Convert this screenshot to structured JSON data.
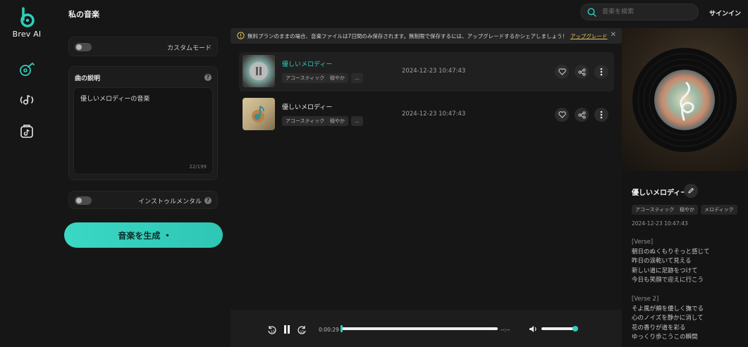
{
  "app": {
    "name": "Brev AI",
    "brand_color": "#2ecfbb"
  },
  "header": {
    "title": "私の音楽",
    "search_placeholder": "音楽を検索",
    "signin": "サインイン"
  },
  "sidebar": {
    "items": [
      {
        "icon": "music-disc-icon",
        "active": true
      },
      {
        "icon": "music-broadcast-icon",
        "active": false
      },
      {
        "icon": "tiktok-bag-icon",
        "active": false
      }
    ]
  },
  "left_panel": {
    "custom_mode_label": "カスタムモード",
    "description_label": "曲の説明",
    "description_value": "優しいメロディーの音楽",
    "char_count": "22/199",
    "instrumental_label": "インストゥルメンタル",
    "generate_button": "音楽を生成",
    "generate_dot": "•"
  },
  "notice": {
    "text": "無料プランのままの場合、音楽ファイルは7日間のみ保存されます。無制限で保存するには、アップグレードするかシェアしましょう！",
    "link": "アップグレード"
  },
  "tracks": [
    {
      "title": "優しいメロディー",
      "tags": [
        "アコースティック",
        "穏やか",
        "..."
      ],
      "date": "2024-12-23 10:47:43",
      "playing": true
    },
    {
      "title": "優しいメロディー",
      "tags": [
        "アコースティック",
        "穏やか",
        "..."
      ],
      "date": "2024-12-23 10:47:43",
      "playing": false
    }
  ],
  "player": {
    "current_time": "0:00:29",
    "total_time": "--:--",
    "progress": 0.0,
    "volume": 0.95
  },
  "detail": {
    "title": "優しいメロディー",
    "tags": [
      "アコースティック",
      "穏やか",
      "メロディック"
    ],
    "date": "2024-12-23 10:47:43",
    "lyrics": [
      {
        "section": "[Verse]",
        "lines": [
          "朝日のぬくもりそっと感じて",
          "昨日の涙乾いて見える",
          "新しい道に足跡をつけて",
          "今日も笑顔で迎えに行こう"
        ]
      },
      {
        "section": "[Verse 2]",
        "lines": [
          "そよ風が頬を優しく撫でる",
          "心のノイズを静かに消して",
          "花の香りが道を彩る",
          "ゆっくり歩こうこの瞬間"
        ]
      }
    ]
  }
}
